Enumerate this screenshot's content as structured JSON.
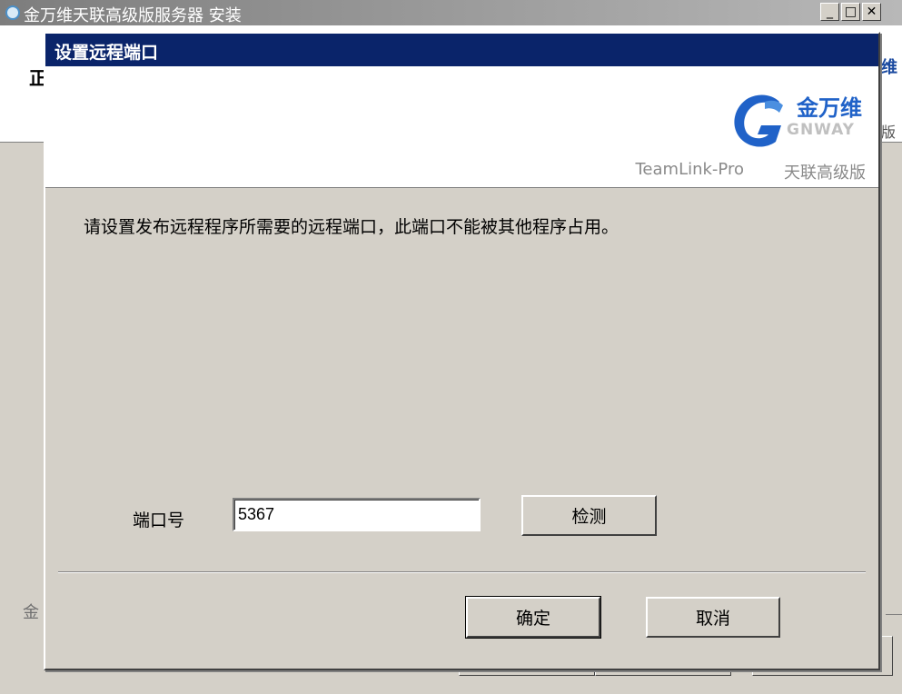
{
  "background_window": {
    "title": "金万维天联高级版服务器 安装",
    "controls": [
      "_",
      "□",
      "✕"
    ],
    "fragment_left": "正",
    "fragment_right_top": "维",
    "fragment_right_bottom": "版",
    "footer_left": "金"
  },
  "dialog": {
    "title": "设置远程端口",
    "logo": {
      "brand_cn": "金万维",
      "brand_en": "GNWAY",
      "product": "TeamLink-Pro",
      "edition": "天联高级版",
      "icon": "gnway-g-logo-icon",
      "color": "#2062c8"
    },
    "instruction": "请设置发布远程程序所需要的远程端口，此端口不能被其他程序占用。",
    "port": {
      "label": "端口号",
      "value": "5367"
    },
    "buttons": {
      "check": "检测",
      "ok": "确定",
      "cancel": "取消"
    }
  },
  "colors": {
    "titlebar": "#0a246a",
    "face": "#d4d0c8"
  }
}
